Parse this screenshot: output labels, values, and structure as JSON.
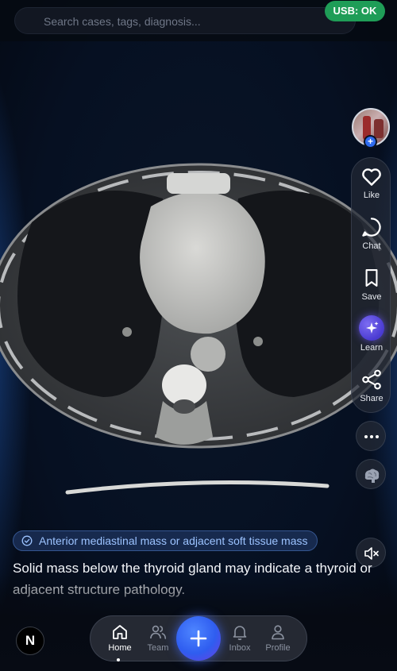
{
  "search": {
    "placeholder": "Search cases, tags, diagnosis..."
  },
  "status": {
    "usb": "USB: OK",
    "usb_color": "#1f9d57"
  },
  "actions": {
    "like": "Like",
    "chat": "Chat",
    "save": "Save",
    "learn": "Learn",
    "share": "Share"
  },
  "case": {
    "tag": "Anterior mediastinal mass or adjacent soft tissue mass",
    "description": "Solid mass below the thyroid gland may indicate a thyroid or adjacent structure pathology."
  },
  "logo": {
    "letter": "N"
  },
  "nav": {
    "items": [
      {
        "label": "Home",
        "icon": "home-icon",
        "active": true
      },
      {
        "label": "Team",
        "icon": "team-icon"
      },
      {
        "label": "Inbox",
        "icon": "bell-icon"
      },
      {
        "label": "Profile",
        "icon": "profile-icon"
      }
    ]
  },
  "colors": {
    "accent": "#2f6cf0",
    "learn": "#5b4be0",
    "tag_text": "#9cc3ff"
  }
}
